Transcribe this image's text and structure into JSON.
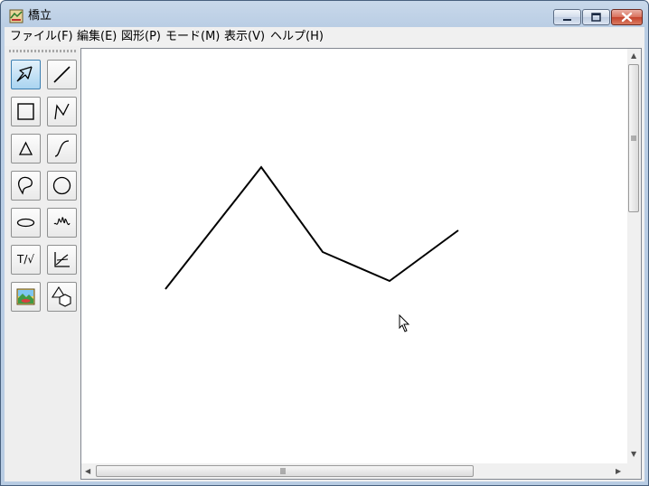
{
  "window": {
    "title": "橋立"
  },
  "menu": {
    "items": [
      {
        "label": "ファイル(F)"
      },
      {
        "label": "編集(E)"
      },
      {
        "label": "図形(P)"
      },
      {
        "label": "モード(M)"
      },
      {
        "label": "表示(V)"
      },
      {
        "label": "ヘルプ(H)"
      }
    ]
  },
  "toolbox": {
    "tools": [
      {
        "icon": "select-arrow-icon",
        "active": true
      },
      {
        "icon": "line-icon"
      },
      {
        "icon": "rectangle-icon"
      },
      {
        "icon": "polyline-icon"
      },
      {
        "icon": "triangle-icon"
      },
      {
        "icon": "curve-icon"
      },
      {
        "icon": "freeform-shape-icon"
      },
      {
        "icon": "circle-icon"
      },
      {
        "icon": "ellipse-icon"
      },
      {
        "icon": "spiral-icon"
      },
      {
        "icon": "text-formula-icon",
        "label": "T/√"
      },
      {
        "icon": "graph-icon"
      },
      {
        "icon": "image-icon"
      },
      {
        "icon": "shapes-library-icon"
      }
    ]
  },
  "canvas": {
    "drawing": {
      "shape": "polyline",
      "stroke_color": "#000000"
    }
  },
  "colors": {
    "window_frame": "#b9cde4",
    "active_tool": "#a9d4f0",
    "close_button": "#c4432d"
  }
}
